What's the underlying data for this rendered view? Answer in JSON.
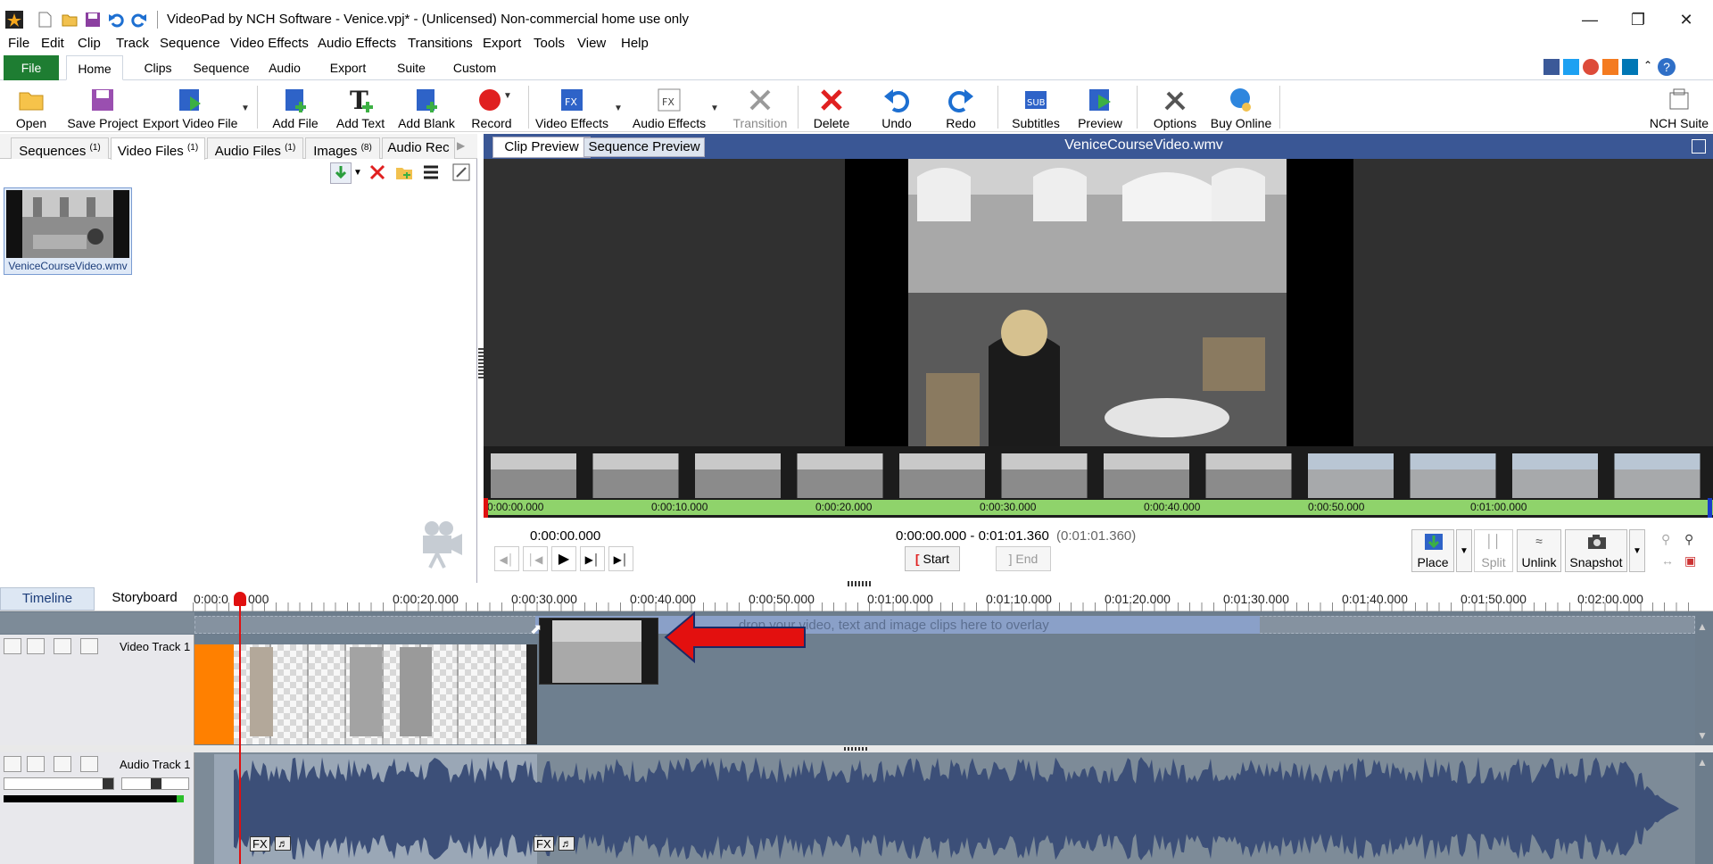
{
  "window": {
    "title": "VideoPad by NCH Software - Venice.vpj* - (Unlicensed) Non-commercial home use only"
  },
  "menu": [
    "File",
    "Edit",
    "Clip",
    "Track",
    "Sequence",
    "Video Effects",
    "Audio Effects",
    "Transitions",
    "Export",
    "Tools",
    "View",
    "Help"
  ],
  "ribbon_tabs": [
    "File",
    "Home",
    "Clips",
    "Sequence",
    "Audio",
    "Export",
    "Suite",
    "Custom"
  ],
  "toolbar": {
    "open": "Open",
    "save_project": "Save Project",
    "export_video": "Export Video File",
    "add_file": "Add File",
    "add_text": "Add Text",
    "add_blank": "Add Blank",
    "record": "Record",
    "video_effects": "Video Effects",
    "audio_effects": "Audio Effects",
    "transition": "Transition",
    "delete": "Delete",
    "undo": "Undo",
    "redo": "Redo",
    "subtitles": "Subtitles",
    "preview": "Preview",
    "options": "Options",
    "buy_online": "Buy Online",
    "nch_suite": "NCH Suite"
  },
  "media_tabs": [
    {
      "label": "Sequences",
      "count": "(1)"
    },
    {
      "label": "Video Files",
      "count": "(1)"
    },
    {
      "label": "Audio Files",
      "count": "(1)"
    },
    {
      "label": "Images",
      "count": "(8)"
    },
    {
      "label": "Audio Rec",
      "count": ""
    }
  ],
  "media_files": [
    {
      "name": "VeniceCourseVideo.wmv"
    }
  ],
  "preview": {
    "tab_clip": "Clip Preview",
    "tab_sequence": "Sequence Preview",
    "file_name": "VeniceCourseVideo.wmv",
    "strip_times": [
      "0:00:00.000",
      "0:00:10.000",
      "0:00:20.000",
      "0:00:30.000",
      "0:00:40.000",
      "0:00:50.000",
      "0:01:00.000"
    ],
    "current_time": "0:00:00.000",
    "range_start": "0:00:00.000",
    "range_sep": "-",
    "range_end": "0:01:01.360",
    "range_duration": "(0:01:01.360)",
    "start_label": "Start",
    "end_label": "End",
    "tools": {
      "place": "Place",
      "split": "Split",
      "unlink": "Unlink",
      "snapshot": "Snapshot"
    }
  },
  "timeline": {
    "tab_timeline": "Timeline",
    "tab_storyboard": "Storyboard",
    "ruler": [
      "0:00:0",
      "000",
      "0:00:20.000",
      "0:00:30.000",
      "0:00:40.000",
      "0:00:50.000",
      "0:01:00.000",
      "0:01:10.000",
      "0:01:20.000",
      "0:01:30.000",
      "0:01:40.000",
      "0:01:50.000",
      "0:02:00.000"
    ],
    "overlay_hint": "drop your video, text and image clips here to overlay",
    "video_track": "Video Track 1",
    "audio_track": "Audio Track 1",
    "fx_label": "FX"
  },
  "colors": {
    "accent_green": "#1e7d32",
    "header_blue": "#3a5795",
    "strip_green": "#8fd36b",
    "timeline_bg": "#6d7d8c",
    "arrow_red": "#e3100f",
    "playhead": "#e01010",
    "clip_orange": "#ff8000",
    "waveform": "#3c4f78"
  }
}
